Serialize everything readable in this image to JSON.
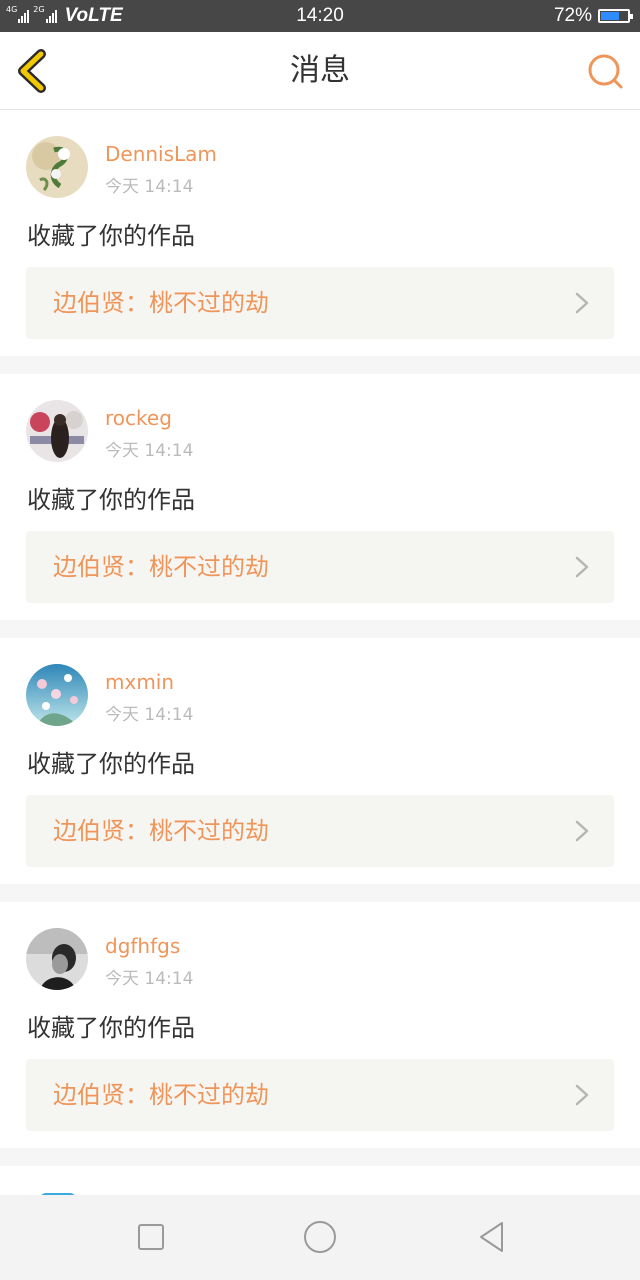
{
  "status_bar": {
    "net1": "4G",
    "net2": "2G",
    "carrier_mode": "VoLTE",
    "time": "14:20",
    "battery_text": "72%",
    "battery_level": 0.72
  },
  "header": {
    "title": "消息",
    "back_icon": "chevron-left-icon",
    "search_icon": "search-icon"
  },
  "messages": [
    {
      "username": "DennisLam",
      "time": "今天 14:14",
      "action": "收藏了你的作品",
      "work": "边伯贤：桃不过的劫"
    },
    {
      "username": "rockeg",
      "time": "今天 14:14",
      "action": "收藏了你的作品",
      "work": "边伯贤：桃不过的劫"
    },
    {
      "username": "mxmin",
      "time": "今天 14:14",
      "action": "收藏了你的作品",
      "work": "边伯贤：桃不过的劫"
    },
    {
      "username": "dgfhfgs",
      "time": "今天 14:14",
      "action": "收藏了你的作品",
      "work": "边伯贤：桃不过的劫"
    }
  ],
  "nav_bar": {
    "recent_icon": "square-icon",
    "home_icon": "circle-icon",
    "back_icon": "triangle-back-icon"
  },
  "colors": {
    "accent": "#f0955a",
    "status_bar_bg": "#474747",
    "battery_fill": "#2f8cff",
    "back_arrow": "#f2c800"
  }
}
